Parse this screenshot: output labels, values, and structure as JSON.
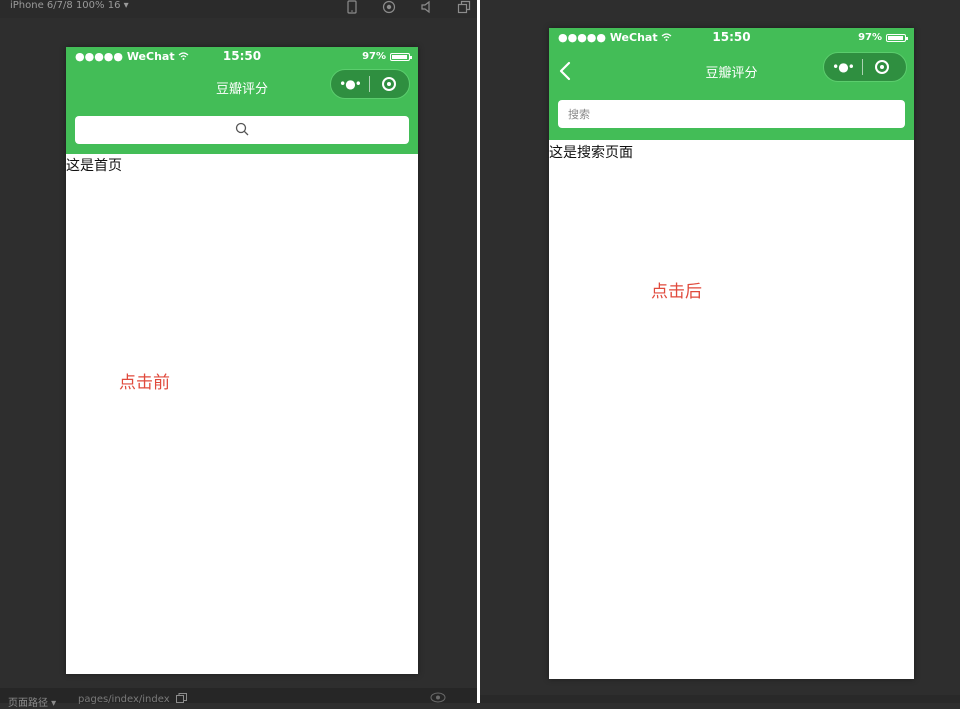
{
  "toolbar": {
    "device": "iPhone 6/7/8 100% 16 ▾"
  },
  "bottombar": {
    "path_label": "页面路径 ▾",
    "path_value": "pages/index/index"
  },
  "left_phone": {
    "status": {
      "carrier": "●●●●● WeChat",
      "time": "15:50",
      "battery": "97%"
    },
    "nav_title": "豆瓣评分",
    "capsule": {
      "more": "•●•"
    },
    "page_text": "这是首页",
    "annotation": "点击前"
  },
  "right_phone": {
    "status": {
      "carrier": "●●●●● WeChat",
      "time": "15:50",
      "battery": "97%"
    },
    "nav_title": "豆瓣评分",
    "capsule": {
      "more": "•●•"
    },
    "search": {
      "placeholder": "搜索"
    },
    "page_text": "这是搜索页面",
    "annotation": "点击后"
  },
  "colors": {
    "header_green": "#43bd57",
    "annotation_red": "#e04a3c"
  },
  "icons": [
    "wifi-icon",
    "search-icon",
    "back-icon",
    "more-icon",
    "target-icon",
    "phone-icon",
    "record-icon",
    "volume-icon",
    "window-icon",
    "copy-icon",
    "eye-icon"
  ]
}
